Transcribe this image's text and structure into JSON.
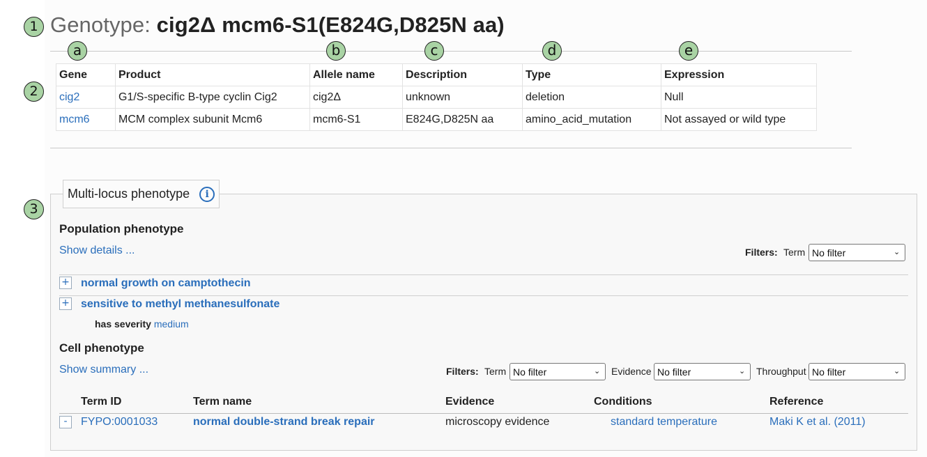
{
  "header": {
    "prefix": "Genotype:",
    "genotype": "cig2Δ mcm6-S1(E824G,D825N aa)"
  },
  "badges": {
    "one": "1",
    "two": "2",
    "three": "3",
    "a": "a",
    "b": "b",
    "c": "c",
    "d": "d",
    "e": "e"
  },
  "alleles": {
    "columns": [
      "Gene",
      "Product",
      "Allele name",
      "Description",
      "Type",
      "Expression"
    ],
    "rows": [
      {
        "gene": "cig2",
        "product": "G1/S-specific B-type cyclin Cig2",
        "allele": "cig2Δ",
        "description": "unknown",
        "type": "deletion",
        "expression": "Null"
      },
      {
        "gene": "mcm6",
        "product": "MCM complex subunit Mcm6",
        "allele": "mcm6-S1",
        "description": "E824G,D825N aa",
        "type": "amino_acid_mutation",
        "expression": "Not assayed or wild type"
      }
    ]
  },
  "phenotype": {
    "legend": "Multi-locus phenotype",
    "population": {
      "heading": "Population phenotype",
      "show_details": "Show details ...",
      "filters_label": "Filters:",
      "term_label": "Term",
      "term_value": "No filter",
      "terms": [
        {
          "toggle": "+",
          "name": "normal growth on camptothecin"
        },
        {
          "toggle": "+",
          "name": "sensitive to methyl methanesulfonate"
        }
      ],
      "severity_label": "has severity",
      "severity_value": "medium"
    },
    "cell": {
      "heading": "Cell phenotype",
      "show_summary": "Show summary ...",
      "filters_label": "Filters:",
      "term_label": "Term",
      "term_value": "No filter",
      "evidence_label": "Evidence",
      "evidence_value": "No filter",
      "throughput_label": "Throughput",
      "throughput_value": "No filter",
      "columns": [
        "Term ID",
        "Term name",
        "Evidence",
        "Conditions",
        "Reference"
      ],
      "rows": [
        {
          "toggle": "-",
          "term_id": "FYPO:0001033",
          "term_name": "normal double-strand break repair",
          "evidence": "microscopy evidence",
          "conditions": "standard temperature",
          "reference": "Maki K et al. (2011)"
        }
      ]
    }
  },
  "colors": {
    "link": "#2a6ebb",
    "badge": "#a9d3a4"
  }
}
